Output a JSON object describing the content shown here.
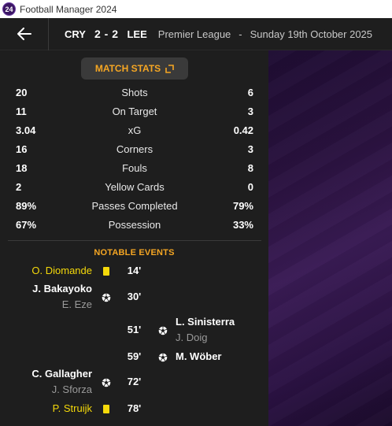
{
  "window": {
    "title": "Football Manager 2024",
    "icon_text": "24"
  },
  "header": {
    "home_team": "CRY",
    "score": "2 - 2",
    "away_team": "LEE",
    "competition": "Premier League",
    "separator": "-",
    "date": "Sunday 19th October 2025"
  },
  "match_stats_button": "MATCH STATS",
  "stats": [
    {
      "home": "20",
      "label": "Shots",
      "away": "6"
    },
    {
      "home": "11",
      "label": "On Target",
      "away": "3"
    },
    {
      "home": "3.04",
      "label": "xG",
      "away": "0.42"
    },
    {
      "home": "16",
      "label": "Corners",
      "away": "3"
    },
    {
      "home": "18",
      "label": "Fouls",
      "away": "8"
    },
    {
      "home": "2",
      "label": "Yellow Cards",
      "away": "0"
    },
    {
      "home": "89%",
      "label": "Passes Completed",
      "away": "79%"
    },
    {
      "home": "67%",
      "label": "Possession",
      "away": "33%"
    }
  ],
  "notable_events_title": "NOTABLE EVENTS",
  "events": [
    {
      "side": "home",
      "type": "yellow-card",
      "player": "O. Diomande",
      "assist": "",
      "minute": "14'"
    },
    {
      "side": "home",
      "type": "goal",
      "player": "J. Bakayoko",
      "assist": "E. Eze",
      "minute": "30'"
    },
    {
      "side": "away",
      "type": "goal",
      "player": "L. Sinisterra",
      "assist": "J. Doig",
      "minute": "51'"
    },
    {
      "side": "away",
      "type": "goal",
      "player": "M. Wöber",
      "assist": "",
      "minute": "59'"
    },
    {
      "side": "home",
      "type": "goal",
      "player": "C. Gallagher",
      "assist": "J. Sforza",
      "minute": "72'"
    },
    {
      "side": "home",
      "type": "yellow-card",
      "player": "P. Struijk",
      "assist": "",
      "minute": "78'"
    }
  ],
  "colors": {
    "accent": "#f5a623",
    "yellow_card": "#f5d90a",
    "panel": "#1e1e1e",
    "background_purple": "#3a1b55"
  }
}
